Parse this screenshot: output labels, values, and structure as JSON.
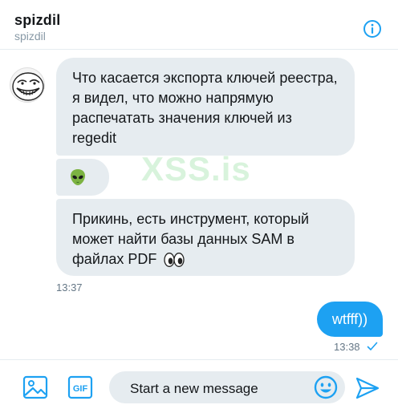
{
  "header": {
    "title": "spizdil",
    "subtitle": "spizdil"
  },
  "messages": {
    "incoming": [
      "Что касается экспорта ключей реестра, я видел, что можно напрямую распечатать значения ключей из regedit",
      "Прикинь, есть инструмент, который может найти базы данных SAM в файлах PDF"
    ],
    "incoming_time": "13:37",
    "outgoing": "wtfff))",
    "outgoing_time": "13:38"
  },
  "watermark": "XSS.is",
  "composer": {
    "placeholder": "Start a new message",
    "gif_label": "GIF"
  },
  "colors": {
    "accent": "#1da1f2",
    "bubble_in": "#e6ecf0"
  }
}
